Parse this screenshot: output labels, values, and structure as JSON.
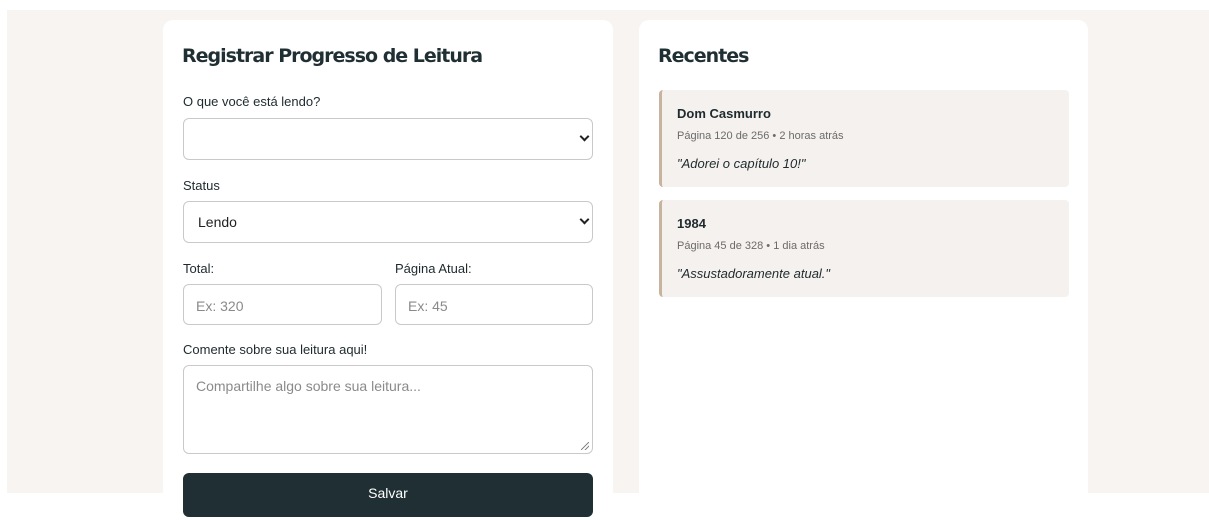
{
  "form": {
    "heading": "Registrar Progresso de Leitura",
    "book_label": "O que você está lendo?",
    "book_value": "",
    "status_label": "Status",
    "status_value": "Lendo",
    "total_label": "Total:",
    "total_placeholder": "Ex: 320",
    "page_label": "Página Atual:",
    "page_placeholder": "Ex: 45",
    "comment_label": "Comente sobre sua leitura aqui!",
    "comment_placeholder": "Compartilhe algo sobre sua leitura...",
    "save_label": "Salvar"
  },
  "recent": {
    "heading": "Recentes",
    "items": [
      {
        "title": "Dom Casmurro",
        "meta": "Página 120 de 256 • 2 horas atrás",
        "comment": "\"Adorei o capítulo 10!\""
      },
      {
        "title": "1984",
        "meta": "Página 45 de 328 • 1 dia atrás",
        "comment": "\"Assustadoramente atual.\""
      }
    ]
  },
  "colors": {
    "page_background": "#f7f4f1",
    "primary_dark": "#1f2f33",
    "recent_background": "#f5f1ee",
    "recent_accent": "#c8b49e"
  }
}
